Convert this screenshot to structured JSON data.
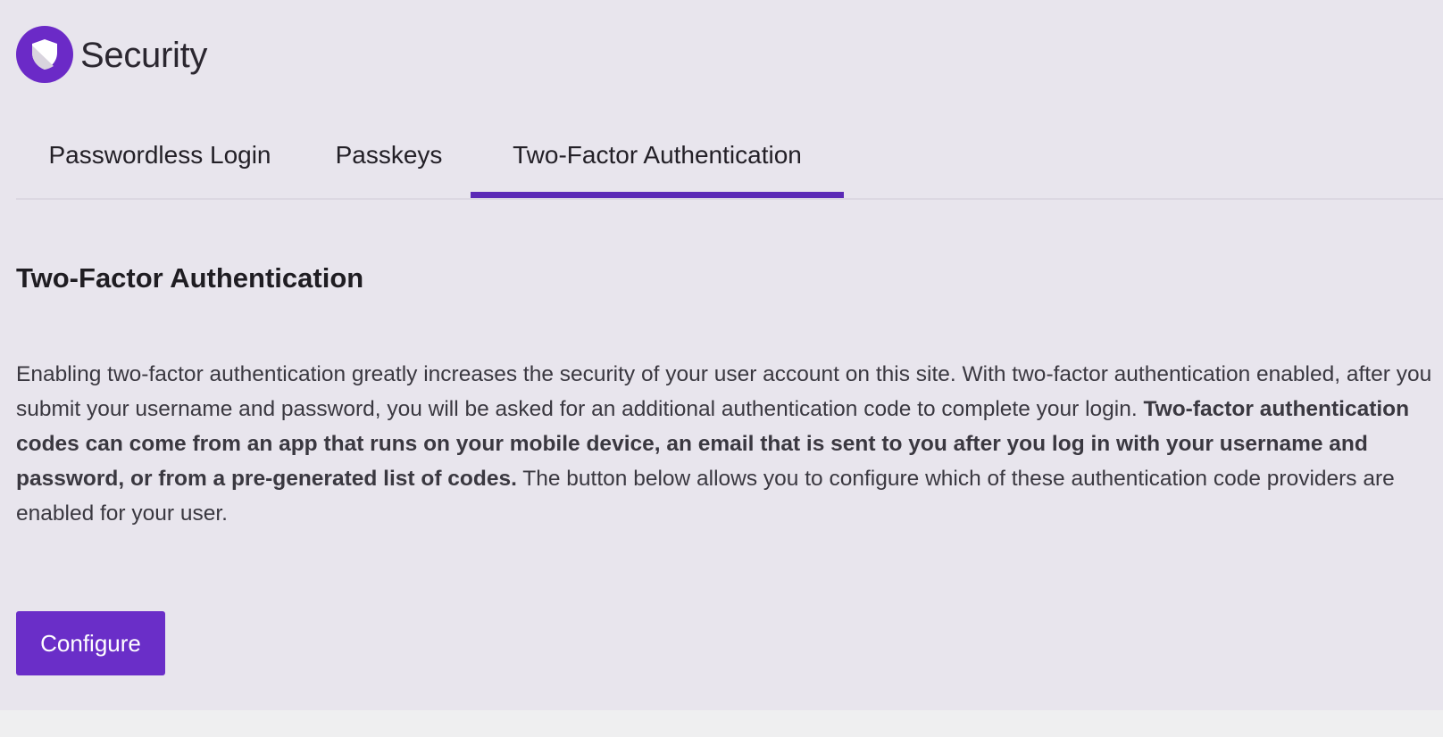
{
  "app": {
    "title": "Security",
    "logo_icon": "shield-icon",
    "accent_color": "#6b2ac7"
  },
  "tabs": [
    {
      "label": "Passwordless Login",
      "active": false
    },
    {
      "label": "Passkeys",
      "active": false
    },
    {
      "label": "Two-Factor Authentication",
      "active": true
    }
  ],
  "main": {
    "title": "Two-Factor Authentication",
    "description": {
      "part1": "Enabling two-factor authentication greatly increases the security of your user account on this site. With two-factor authentication enabled, after you submit your username and password, you will be asked for an additional authentication code to complete your login. ",
      "bold": "Two-factor authentication codes can come from an app that runs on your mobile device, an email that is sent to you after you log in with your username and password, or from a pre-generated list of codes.",
      "part2": " The button below allows you to configure which of these authentication code providers are enabled for your user."
    },
    "configure_label": "Configure"
  }
}
